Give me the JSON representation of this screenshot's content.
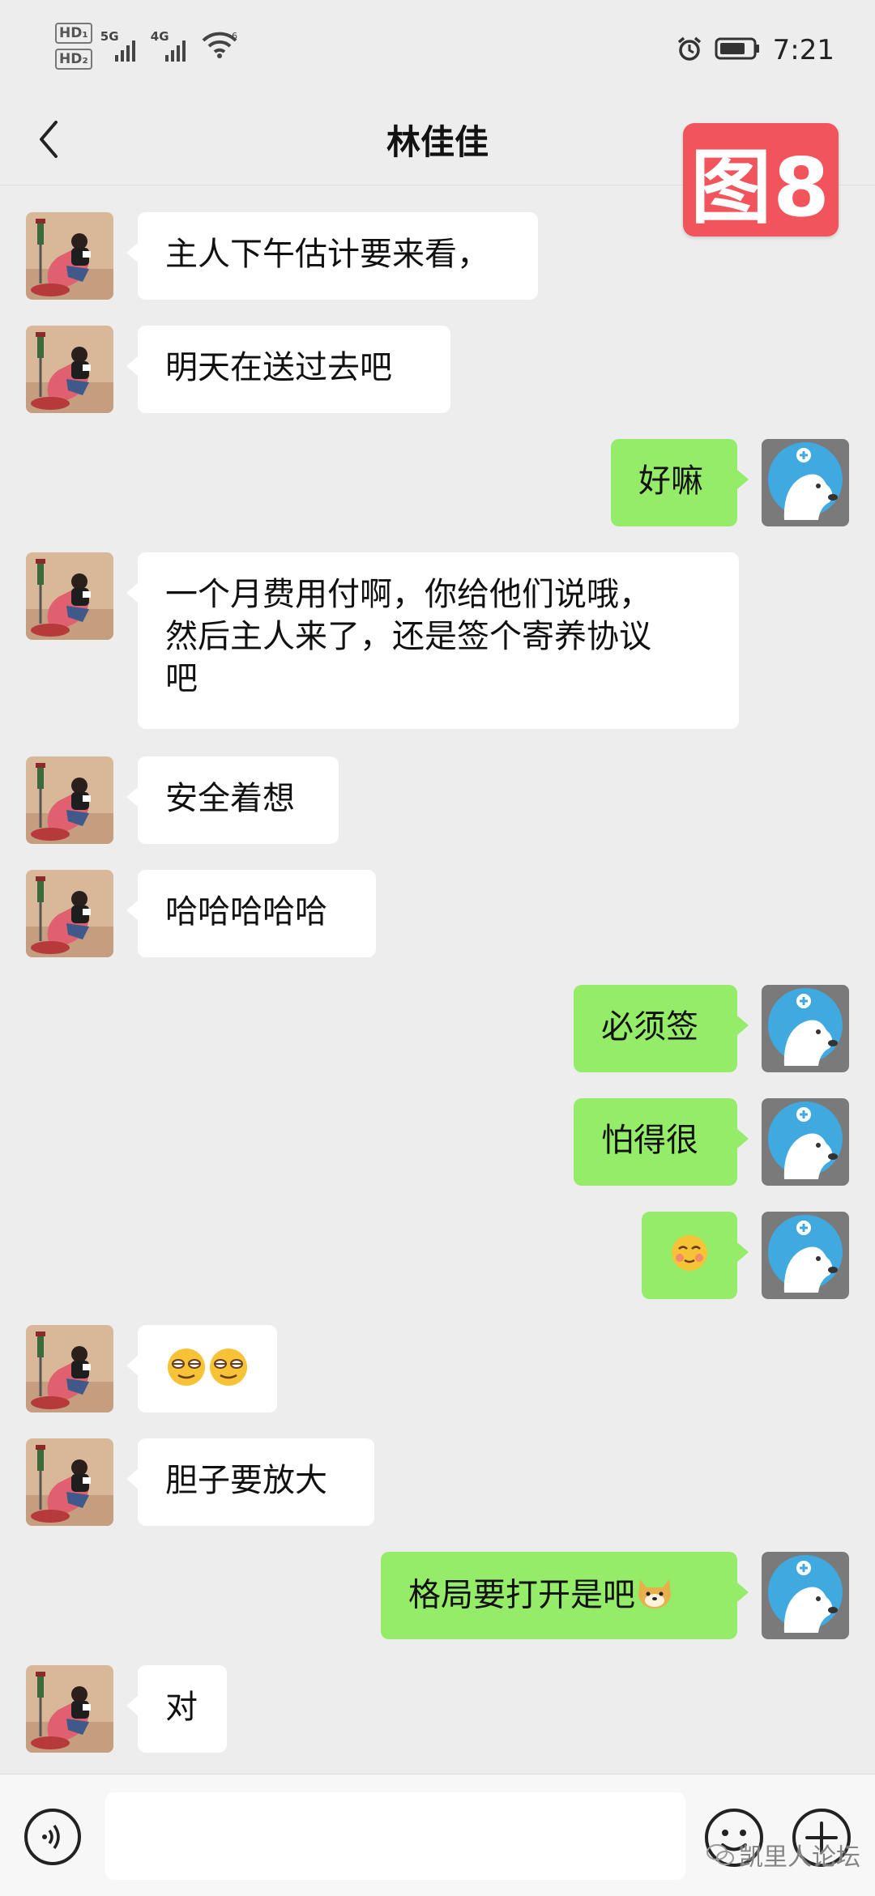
{
  "status_bar": {
    "hd1": "HD₁",
    "hd2": "HD₂",
    "net1": "5G",
    "net2": "4G",
    "wifi_label": "6",
    "time": "7:21"
  },
  "header": {
    "title": "林佳佳",
    "back_icon": "chevron-left-icon",
    "more_icon": "more-dots-icon"
  },
  "stamp": {
    "text": "图8"
  },
  "messages": [
    {
      "side": "in",
      "text": "主人下午估计要来看，"
    },
    {
      "side": "in",
      "text": "明天在送过去吧"
    },
    {
      "side": "out",
      "text": "好嘛"
    },
    {
      "side": "in",
      "text": "一个月费用付啊，你给他们说哦，\n然后主人来了，还是签个寄养协议\n吧"
    },
    {
      "side": "in",
      "text": "安全着想"
    },
    {
      "side": "in",
      "text": "哈哈哈哈哈"
    },
    {
      "side": "out",
      "text": "必须签"
    },
    {
      "side": "out",
      "text": "怕得很"
    },
    {
      "side": "out",
      "text": "",
      "emoji": "blush-face-emoji"
    },
    {
      "side": "in",
      "text": "",
      "emoji": "squint-face-emoji"
    },
    {
      "side": "in",
      "text": "胆子要放大"
    },
    {
      "side": "out",
      "text": "格局要打开是吧",
      "emoji": "doge-emoji"
    },
    {
      "side": "in",
      "text": "对"
    }
  ],
  "input_bar": {
    "voice_icon": "voice-icon",
    "emoji_icon": "emoji-icon",
    "plus_icon": "plus-icon",
    "input_value": ""
  },
  "watermark": {
    "text": "凯里人论坛"
  },
  "colors": {
    "background": "#ededed",
    "incoming_bubble": "#ffffff",
    "outgoing_bubble": "#95ec69",
    "stamp": "#f2545b"
  }
}
